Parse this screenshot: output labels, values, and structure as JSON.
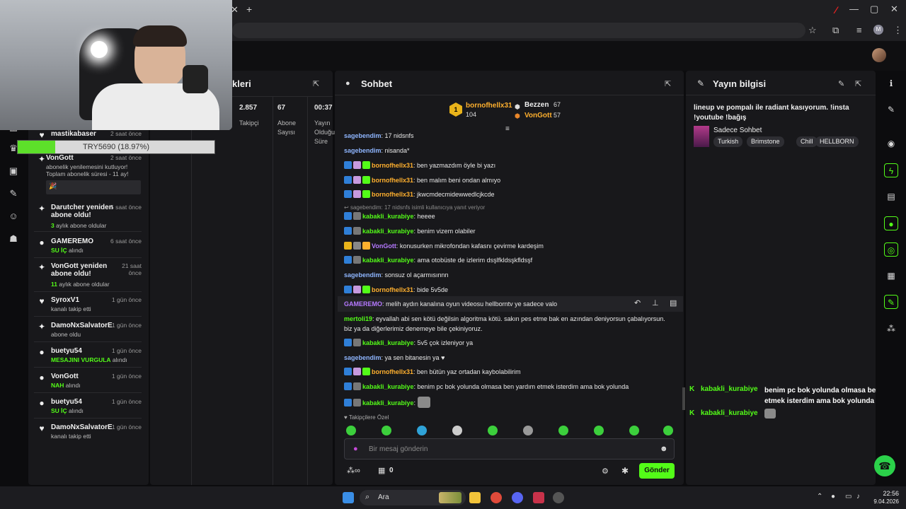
{
  "browser": {
    "new_tab": "+",
    "avatar_letter": "M"
  },
  "overlay": {
    "donation_goal": "TRY5690 (18.97%)",
    "goal_progress": 0.1897
  },
  "activity": [
    {
      "name": "mastikabaser",
      "time": "2 saat önce",
      "sub": ""
    },
    {
      "name": "VonGott",
      "time": "2 saat önce",
      "sub": "abonelik yenilemesini kutluyor! Toplam abonelik süresi - 11 ay!",
      "months": "11"
    },
    {
      "name": "Darutcher yeniden abone oldu!",
      "time": "5 saat önce",
      "green": "3",
      "sub": " aylık abone oldular"
    },
    {
      "name": "GAMEREMO",
      "time": "6 saat önce",
      "green": "SU İÇ",
      "sub": " alındı"
    },
    {
      "name": "VonGott yeniden abone oldu!",
      "time": "21 saat önce",
      "green": "11",
      "sub": " aylık abone oldular"
    },
    {
      "name": "SyroxV1",
      "time": "1 gün önce",
      "sub": "kanalı takip etti"
    },
    {
      "name": "DamoNxSalvatorE",
      "time": "1 gün önce",
      "sub": "abone oldu"
    },
    {
      "name": "buetyu54",
      "time": "1 gün önce",
      "green": "MESAJINI VURGULA",
      "sub": " alındı"
    },
    {
      "name": "VonGott",
      "time": "1 gün önce",
      "green": "NAH",
      "sub": " alındı"
    },
    {
      "name": "buetyu54",
      "time": "1 gün önce",
      "green": "SU İÇ",
      "sub": " alındı"
    },
    {
      "name": "DamoNxSalvatorE",
      "time": "1 gün önce",
      "sub": "kanalı takip etti"
    }
  ],
  "stats": {
    "title_partial": "kleri",
    "followers_value": "2.857",
    "followers_label": "Takipçi",
    "subs_value": "67",
    "subs_label1": "Abone",
    "subs_label2": "Sayısı",
    "duration_value": "00:37",
    "duration_label1": "Yayın",
    "duration_label2": "Olduğu",
    "duration_label3": "Süre"
  },
  "chat": {
    "title": "Sohbet",
    "top": [
      {
        "rank": "1",
        "name": "bornofhellx31",
        "count": "104"
      },
      {
        "name": "Bezzen",
        "count": "67"
      },
      {
        "name": "VonGott",
        "count": "57"
      }
    ],
    "messages": [
      {
        "user": "sagebendim",
        "text": ": 17 nidsnfs",
        "color": "blue"
      },
      {
        "user": "sagebendim",
        "text": ": nisanda*",
        "color": "blue"
      },
      {
        "user": "bornofhellx31",
        "text": ": ben yazmazdım öyle bi yazı",
        "color": "orange"
      },
      {
        "user": "bornofhellx31",
        "text": ": ben malım beni ondan almıyo",
        "color": "orange"
      },
      {
        "user": "bornofhellx31",
        "text": ": jkwcmdecmidewwedlcjkcde",
        "color": "orange"
      },
      {
        "reply": "sagebendim: 17 nidsnfs isimli kullanıcıya yanıt veriyor"
      },
      {
        "user": "kabakli_kurabiye",
        "text": ": heeee",
        "color": "green"
      },
      {
        "user": "kabakli_kurabiye",
        "text": ": benim vizem olabiler",
        "color": "green"
      },
      {
        "user": "VonGott",
        "text": ": konusurken mikrofondan kafasnı çevirme kardeşim",
        "color": "purple"
      },
      {
        "user": "kabakli_kurabiye",
        "text": ": ama otobüste de izlerim dsşlfkldsşkfldsşf",
        "color": "green"
      },
      {
        "user": "sagebendim",
        "text": ": sonsuz ol açarmısınnn",
        "color": "blue"
      },
      {
        "user": "bornofhellx31",
        "text": ": bide 5v5de",
        "color": "orange"
      },
      {
        "user": "GAMEREMO",
        "text": ": melih aydın kanalına oyun videosu hellborntv ye sadece valo",
        "color": "purple"
      },
      {
        "user": "mertoli19",
        "text": ": eyvallah abi sen kötü değilsin algoritma kötü. sakın pes etme bak en azından deniyorsun çabalıyorsun.",
        "text2": "biz ya da diğerlerimiz denemeye bile çekiniyoruz.",
        "color": "green"
      },
      {
        "user": "kabakli_kurabiye",
        "text": ": 5v5 çok izleniyor ya",
        "color": "green"
      },
      {
        "user": "sagebendim",
        "text": ": ya sen bitanesin ya ♥",
        "color": "blue"
      },
      {
        "user": "bornofhellx31",
        "text": ": ben bütün yaz ortadan kaybolabilirim",
        "color": "orange"
      },
      {
        "user": "kabakli_kurabiye",
        "text": ": benim pc bok yolunda olmasa ben yardım etmek isterdim ama bok yolunda",
        "color": "green"
      },
      {
        "user": "kabakli_kurabiye",
        "text": ": ",
        "color": "green"
      }
    ],
    "followers_only": "Takipçilere Özel",
    "input_placeholder": "Bir mesaj gönderin",
    "points": "0",
    "send": "Gönder"
  },
  "info": {
    "title": "Yayın bilgisi",
    "description": "lineup ve pompalı ile radiant kasıyorum. !insta !youtube !bağış",
    "category": "Sadece Sohbet",
    "tags": [
      "Turkish",
      "Brimstone",
      "Chill",
      "HELLBORN"
    ],
    "overlay_msgs": [
      {
        "user": "kabakli_kurabiye",
        "text": "benim pc bok yolunda olmasa ben yardım etmek isterdim ama bok yolunda"
      },
      {
        "user": "kabakli_kurabiye",
        "text": ""
      }
    ]
  },
  "taskbar": {
    "search": "Ara",
    "time": "22:56",
    "date": "9.04.2026"
  },
  "colors": {
    "accent": "#53fc18",
    "panel": "#18181b"
  }
}
